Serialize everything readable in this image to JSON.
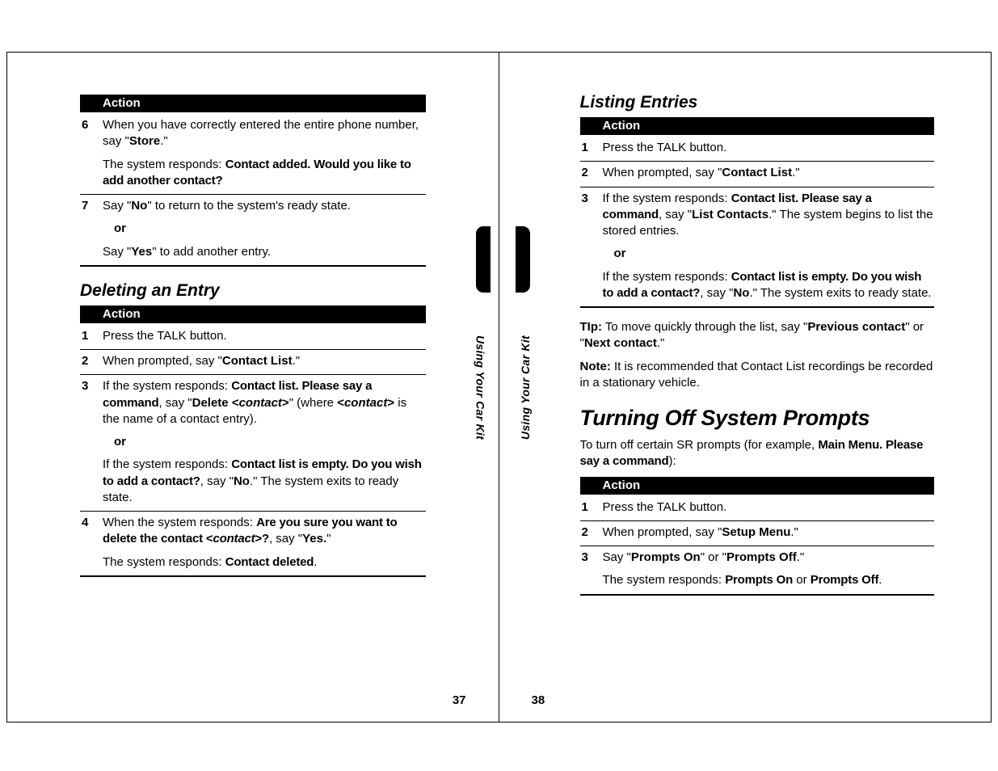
{
  "spine_label": "Using Your Car Kit",
  "left_page": {
    "page_number": "37",
    "table1": {
      "header": "Action",
      "rows": [
        {
          "num": "6",
          "paras": [
            {
              "runs": [
                {
                  "t": "When you have correctly entered the entire phone number, say \""
                },
                {
                  "t": "Store",
                  "cls": "b"
                },
                {
                  "t": ".\""
                }
              ]
            },
            {
              "runs": [
                {
                  "t": "The system responds: "
                },
                {
                  "t": "Contact added. Would you like to add another contact?",
                  "cls": "sv"
                }
              ]
            }
          ]
        },
        {
          "num": "7",
          "paras": [
            {
              "runs": [
                {
                  "t": "Say \""
                },
                {
                  "t": "No",
                  "cls": "b"
                },
                {
                  "t": "\" to return to the system's ready state."
                }
              ]
            },
            {
              "cls": "or",
              "runs": [
                {
                  "t": "or"
                }
              ]
            },
            {
              "runs": [
                {
                  "t": "Say \""
                },
                {
                  "t": "Yes",
                  "cls": "b"
                },
                {
                  "t": "\" to add another entry."
                }
              ]
            }
          ]
        }
      ]
    },
    "sub_heading": "Deleting an Entry",
    "table2": {
      "header": "Action",
      "rows": [
        {
          "num": "1",
          "paras": [
            {
              "runs": [
                {
                  "t": "Press the TALK button."
                }
              ]
            }
          ]
        },
        {
          "num": "2",
          "paras": [
            {
              "runs": [
                {
                  "t": "When prompted, say \""
                },
                {
                  "t": "Contact List",
                  "cls": "b"
                },
                {
                  "t": ".\""
                }
              ]
            }
          ]
        },
        {
          "num": "3",
          "paras": [
            {
              "runs": [
                {
                  "t": "If the system responds: "
                },
                {
                  "t": "Contact list. Please say a command",
                  "cls": "sv"
                },
                {
                  "t": ", say \""
                },
                {
                  "t": "Delete <",
                  "cls": "b"
                },
                {
                  "t": "contact",
                  "cls": "bi"
                },
                {
                  "t": ">",
                  "cls": "b"
                },
                {
                  "t": "\" (where "
                },
                {
                  "t": "<",
                  "cls": "b"
                },
                {
                  "t": "contact",
                  "cls": "bi"
                },
                {
                  "t": ">",
                  "cls": "b"
                },
                {
                  "t": " is the name of a contact entry)."
                }
              ]
            },
            {
              "cls": "or",
              "runs": [
                {
                  "t": "or"
                }
              ]
            },
            {
              "runs": [
                {
                  "t": "If the system responds: "
                },
                {
                  "t": "Contact list is empty. Do you wish to add a contact?",
                  "cls": "sv"
                },
                {
                  "t": ", say \""
                },
                {
                  "t": "No",
                  "cls": "b"
                },
                {
                  "t": ".\" The system exits to ready state."
                }
              ]
            }
          ]
        },
        {
          "num": "4",
          "paras": [
            {
              "runs": [
                {
                  "t": "When the system responds: "
                },
                {
                  "t": "Are you sure you want to delete the contact <",
                  "cls": "sv"
                },
                {
                  "t": "contact",
                  "cls": "sv",
                  "style": "font-style:italic"
                },
                {
                  "t": ">?",
                  "cls": "sv"
                },
                {
                  "t": ", say \""
                },
                {
                  "t": "Yes.",
                  "cls": "b"
                },
                {
                  "t": "\""
                }
              ]
            },
            {
              "runs": [
                {
                  "t": "The system responds: "
                },
                {
                  "t": "Contact deleted",
                  "cls": "sv"
                },
                {
                  "t": "."
                }
              ]
            }
          ]
        }
      ]
    }
  },
  "right_page": {
    "page_number": "38",
    "sub_heading": "Listing Entries",
    "table1": {
      "header": "Action",
      "rows": [
        {
          "num": "1",
          "paras": [
            {
              "runs": [
                {
                  "t": "Press the TALK button."
                }
              ]
            }
          ]
        },
        {
          "num": "2",
          "paras": [
            {
              "runs": [
                {
                  "t": "When prompted, say \""
                },
                {
                  "t": "Contact List",
                  "cls": "b"
                },
                {
                  "t": ".\""
                }
              ]
            }
          ]
        },
        {
          "num": "3",
          "paras": [
            {
              "runs": [
                {
                  "t": "If the system responds: "
                },
                {
                  "t": "Contact list. Please say a command",
                  "cls": "sv"
                },
                {
                  "t": ", say \""
                },
                {
                  "t": "List Contacts",
                  "cls": "b"
                },
                {
                  "t": ".\" The system begins to list the stored entries."
                }
              ]
            },
            {
              "cls": "or",
              "runs": [
                {
                  "t": "or"
                }
              ]
            },
            {
              "runs": [
                {
                  "t": "If the system responds: "
                },
                {
                  "t": "Contact list is empty. Do you wish to add a contact?",
                  "cls": "sv"
                },
                {
                  "t": ", say \""
                },
                {
                  "t": "No",
                  "cls": "b"
                },
                {
                  "t": ".\" The system exits to ready state."
                }
              ]
            }
          ]
        }
      ]
    },
    "tip": {
      "runs": [
        {
          "t": "TIp:",
          "cls": "b"
        },
        {
          "t": " To move quickly through the list, say \""
        },
        {
          "t": "Previous contact",
          "cls": "b"
        },
        {
          "t": "\" or \""
        },
        {
          "t": "Next contact",
          "cls": "b"
        },
        {
          "t": ".\""
        }
      ]
    },
    "note": {
      "runs": [
        {
          "t": "Note:",
          "cls": "b"
        },
        {
          "t": " It is recommended that Contact List recordings be recorded in a stationary vehicle."
        }
      ]
    },
    "main_heading": "Turning Off System Prompts",
    "intro": {
      "runs": [
        {
          "t": "To turn off certain SR prompts (for example, "
        },
        {
          "t": "Main Menu. Please say a command",
          "cls": "sv"
        },
        {
          "t": "):"
        }
      ]
    },
    "table2": {
      "header": "Action",
      "rows": [
        {
          "num": "1",
          "paras": [
            {
              "runs": [
                {
                  "t": "Press the TALK button."
                }
              ]
            }
          ]
        },
        {
          "num": "2",
          "paras": [
            {
              "runs": [
                {
                  "t": "When prompted, say \""
                },
                {
                  "t": "Setup Menu",
                  "cls": "b"
                },
                {
                  "t": ".\""
                }
              ]
            }
          ]
        },
        {
          "num": "3",
          "paras": [
            {
              "runs": [
                {
                  "t": "Say \""
                },
                {
                  "t": "Prompts On",
                  "cls": "b"
                },
                {
                  "t": "\" or \""
                },
                {
                  "t": "Prompts Off",
                  "cls": "b"
                },
                {
                  "t": ".\""
                }
              ]
            },
            {
              "runs": [
                {
                  "t": "The system responds: "
                },
                {
                  "t": "Prompts On",
                  "cls": "sv"
                },
                {
                  "t": " or "
                },
                {
                  "t": "Prompts Off",
                  "cls": "sv"
                },
                {
                  "t": "."
                }
              ]
            }
          ]
        }
      ]
    }
  }
}
